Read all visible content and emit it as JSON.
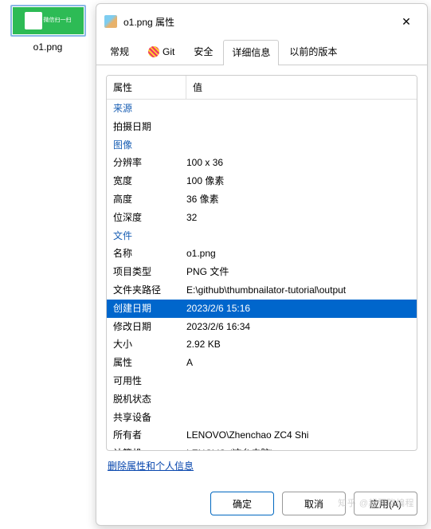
{
  "sidebar": {
    "thumb_caption": "o1.png",
    "thumb_text": "微信扫一扫"
  },
  "dialog": {
    "title": "o1.png 属性"
  },
  "tabs": {
    "general": "常规",
    "git": "Git",
    "security": "安全",
    "details": "详细信息",
    "previous": "以前的版本"
  },
  "grid": {
    "header_prop": "属性",
    "header_val": "值",
    "sections": {
      "origin": "来源",
      "image": "图像",
      "file": "文件"
    },
    "rows": {
      "date_taken": {
        "label": "拍摄日期",
        "value": ""
      },
      "resolution": {
        "label": "分辨率",
        "value": "100 x 36"
      },
      "width": {
        "label": "宽度",
        "value": "100 像素"
      },
      "height": {
        "label": "高度",
        "value": "36 像素"
      },
      "bit_depth": {
        "label": "位深度",
        "value": "32"
      },
      "name": {
        "label": "名称",
        "value": "o1.png"
      },
      "item_type": {
        "label": "项目类型",
        "value": "PNG 文件"
      },
      "folder_path": {
        "label": "文件夹路径",
        "value": "E:\\github\\thumbnailator-tutorial\\output"
      },
      "date_created": {
        "label": "创建日期",
        "value": "2023/2/6 15:16"
      },
      "date_modified": {
        "label": "修改日期",
        "value": "2023/2/6 16:34"
      },
      "size": {
        "label": "大小",
        "value": "2.92 KB"
      },
      "attr": {
        "label": "属性",
        "value": "A"
      },
      "availability": {
        "label": "可用性",
        "value": ""
      },
      "offline": {
        "label": "脱机状态",
        "value": ""
      },
      "shared": {
        "label": "共享设备",
        "value": ""
      },
      "owner": {
        "label": "所有者",
        "value": "LENOVO\\Zhenchao ZC4 Shi"
      },
      "computer": {
        "label": "计算机",
        "value": "LENOVO (这台电脑)"
      }
    }
  },
  "link": "删除属性和个人信息",
  "buttons": {
    "ok": "确定",
    "cancel": "取消",
    "apply": "应用(A)"
  },
  "watermark": "知乎 @超哥聊编程"
}
